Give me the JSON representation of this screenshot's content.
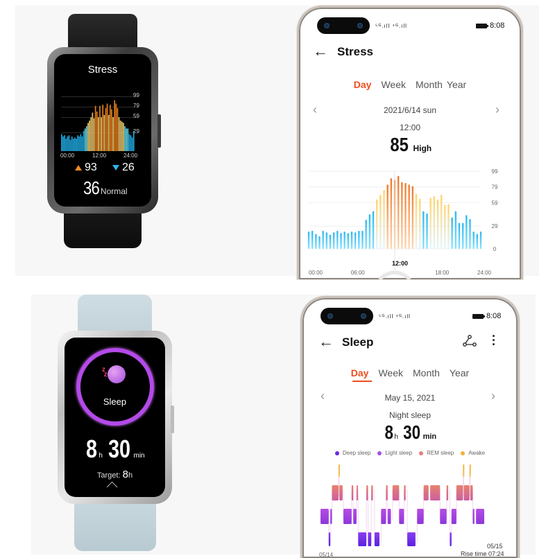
{
  "stress_watch": {
    "title": "Stress",
    "y_ticks": [
      "99",
      "79",
      "59",
      "29"
    ],
    "x_ticks": [
      "00:00",
      "12:00",
      "24:00"
    ],
    "max_value": "93",
    "min_value": "26",
    "current_value": "36",
    "current_level": "Normal",
    "bars": [
      30,
      26,
      28,
      22,
      26,
      28,
      20,
      26,
      22,
      24,
      22,
      28,
      26,
      30,
      26,
      36,
      40,
      44,
      50,
      54,
      60,
      68,
      58,
      80,
      70,
      60,
      80,
      60,
      82,
      64,
      76,
      84,
      64,
      82,
      74,
      60,
      90,
      84,
      76,
      60,
      54,
      52,
      50,
      44,
      40,
      40,
      30,
      28,
      24,
      36
    ]
  },
  "stress_phone": {
    "status_bar": {
      "signal": "⁵ᴳ.ıll ⁴ᴳ.ıll",
      "time": "8:08"
    },
    "title": "Stress",
    "tabs": [
      {
        "label": "Day",
        "active": true
      },
      {
        "label": "Week",
        "active": false
      },
      {
        "label": "Month",
        "active": false
      },
      {
        "label": "Year",
        "active": false
      }
    ],
    "date": "2021/6/14 sun",
    "selected_time": "12:00",
    "selected_value": "85",
    "selected_level": "High",
    "colors": {
      "accent": "#ef4d1e",
      "low": "#33c3f0",
      "medium": "#ffd36b",
      "high": "#f07a2a"
    }
  },
  "chart_data": [
    {
      "type": "bar",
      "title": "Stress",
      "xlabel": "",
      "ylabel": "",
      "x_ticks": [
        "00:00",
        "06:00",
        "12:00",
        "18:00",
        "24:00"
      ],
      "y_ticks": [
        0,
        29,
        59,
        79,
        99
      ],
      "ylim": [
        0,
        99
      ],
      "highlight_tick": "12:00",
      "grid": true,
      "values": [
        22,
        23,
        19,
        16,
        23,
        21,
        18,
        21,
        23,
        20,
        22,
        20,
        22,
        21,
        23,
        23,
        37,
        44,
        48,
        63,
        69,
        75,
        82,
        90,
        88,
        93,
        85,
        84,
        82,
        80,
        70,
        64,
        48,
        45,
        65,
        67,
        63,
        69,
        56,
        57,
        40,
        48,
        33,
        33,
        43,
        38,
        22,
        19,
        22
      ]
    },
    {
      "type": "bar",
      "title": "Night sleep",
      "categories_axis": [
        "05/14",
        "05/15"
      ],
      "legend": [
        "Deep sleep",
        "Light sleep",
        "REM sleep",
        "Awake"
      ],
      "legend_position": "top-center",
      "stages_order_top_to_bottom": [
        "Awake",
        "REM sleep",
        "Light sleep",
        "Deep sleep"
      ],
      "segments": [
        {
          "stage": "Light sleep",
          "start": 0.0,
          "end": 0.05
        },
        {
          "stage": "Deep sleep",
          "start": 0.05,
          "end": 0.06
        },
        {
          "stage": "Light sleep",
          "start": 0.06,
          "end": 0.07
        },
        {
          "stage": "REM sleep",
          "start": 0.07,
          "end": 0.11
        },
        {
          "stage": "Awake",
          "start": 0.11,
          "end": 0.115
        },
        {
          "stage": "REM sleep",
          "start": 0.115,
          "end": 0.135
        },
        {
          "stage": "Light sleep",
          "start": 0.14,
          "end": 0.19
        },
        {
          "stage": "REM sleep",
          "start": 0.19,
          "end": 0.2
        },
        {
          "stage": "Light sleep",
          "start": 0.2,
          "end": 0.22
        },
        {
          "stage": "REM sleep",
          "start": 0.22,
          "end": 0.225
        },
        {
          "stage": "Deep sleep",
          "start": 0.23,
          "end": 0.28
        },
        {
          "stage": "REM sleep",
          "start": 0.28,
          "end": 0.29
        },
        {
          "stage": "Deep sleep",
          "start": 0.29,
          "end": 0.31
        },
        {
          "stage": "REM sleep",
          "start": 0.31,
          "end": 0.32
        },
        {
          "stage": "Deep sleep",
          "start": 0.33,
          "end": 0.36
        },
        {
          "stage": "Light sleep",
          "start": 0.37,
          "end": 0.4
        },
        {
          "stage": "REM sleep",
          "start": 0.4,
          "end": 0.41
        },
        {
          "stage": "Light sleep",
          "start": 0.41,
          "end": 0.43
        },
        {
          "stage": "REM sleep",
          "start": 0.44,
          "end": 0.48
        },
        {
          "stage": "Light sleep",
          "start": 0.48,
          "end": 0.51
        },
        {
          "stage": "REM sleep",
          "start": 0.51,
          "end": 0.52
        },
        {
          "stage": "Deep sleep",
          "start": 0.53,
          "end": 0.58
        },
        {
          "stage": "Light sleep",
          "start": 0.59,
          "end": 0.63
        },
        {
          "stage": "REM sleep",
          "start": 0.63,
          "end": 0.66
        },
        {
          "stage": "REM sleep",
          "start": 0.67,
          "end": 0.73
        },
        {
          "stage": "Light sleep",
          "start": 0.73,
          "end": 0.77
        },
        {
          "stage": "REM sleep",
          "start": 0.77,
          "end": 0.78
        },
        {
          "stage": "Deep sleep",
          "start": 0.79,
          "end": 0.8
        },
        {
          "stage": "Light sleep",
          "start": 0.8,
          "end": 0.83
        },
        {
          "stage": "REM sleep",
          "start": 0.83,
          "end": 0.87
        },
        {
          "stage": "Awake",
          "start": 0.87,
          "end": 0.875
        },
        {
          "stage": "REM sleep",
          "start": 0.875,
          "end": 0.91
        },
        {
          "stage": "Awake",
          "start": 0.91,
          "end": 0.915
        },
        {
          "stage": "REM sleep",
          "start": 0.915,
          "end": 0.93
        },
        {
          "stage": "Light sleep",
          "start": 0.93,
          "end": 0.94
        },
        {
          "stage": "Light sleep",
          "start": 0.95,
          "end": 1.0
        }
      ]
    }
  ],
  "sleep_watch": {
    "title": "Sleep",
    "hours": "8",
    "hours_unit": "h",
    "minutes": "30",
    "minutes_unit": "min",
    "target_label": "Target:",
    "target_value": "8",
    "target_unit": "h"
  },
  "sleep_phone": {
    "status_bar": {
      "signal": "⁵ᴳ.ıll ⁴ᴳ.ıll",
      "time": "8:08"
    },
    "title": "Sleep",
    "tabs": [
      {
        "label": "Day",
        "active": true
      },
      {
        "label": "Week",
        "active": false
      },
      {
        "label": "Month",
        "active": false
      },
      {
        "label": "Year",
        "active": false
      }
    ],
    "date": "May 15, 2021",
    "summary_label": "Night sleep",
    "hours": "8",
    "hours_unit": "h",
    "minutes": "30",
    "minutes_unit": "min",
    "legend": [
      {
        "label": "Deep sleep",
        "color": "#6a2be0"
      },
      {
        "label": "Light sleep",
        "color": "#a54ee6"
      },
      {
        "label": "REM sleep",
        "color": "#e97b7b"
      },
      {
        "label": "Awake",
        "color": "#f2b23a"
      }
    ],
    "start_date": "05/14",
    "end_date": "05/15",
    "rise_time": "Rise time 07:24"
  }
}
